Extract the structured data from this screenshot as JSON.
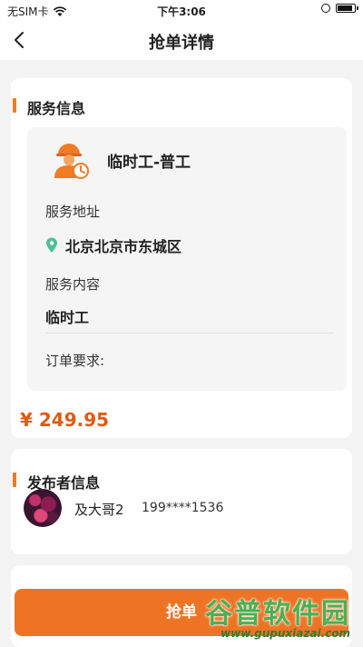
{
  "status_bar": {
    "carrier": "无SIM卡",
    "time": "下午3:06"
  },
  "nav": {
    "title": "抢单详情"
  },
  "service": {
    "section_title": "服务信息",
    "job_title": "临时工-普工",
    "address_label": "服务地址",
    "address": "北京北京市东城区",
    "content_label": "服务内容",
    "content": "临时工",
    "requirements_label": "订单要求:",
    "price": "¥ 249.95"
  },
  "publisher": {
    "section_title": "发布者信息",
    "name": "及大哥2",
    "phone": "199****1536"
  },
  "action": {
    "grab_label": "抢单"
  },
  "watermark": {
    "text": "谷普软件园",
    "url": "www.gupuxiazai.com"
  },
  "colors": {
    "accent": "#f07a26",
    "price": "#e05a12",
    "button": "#ee7425"
  }
}
